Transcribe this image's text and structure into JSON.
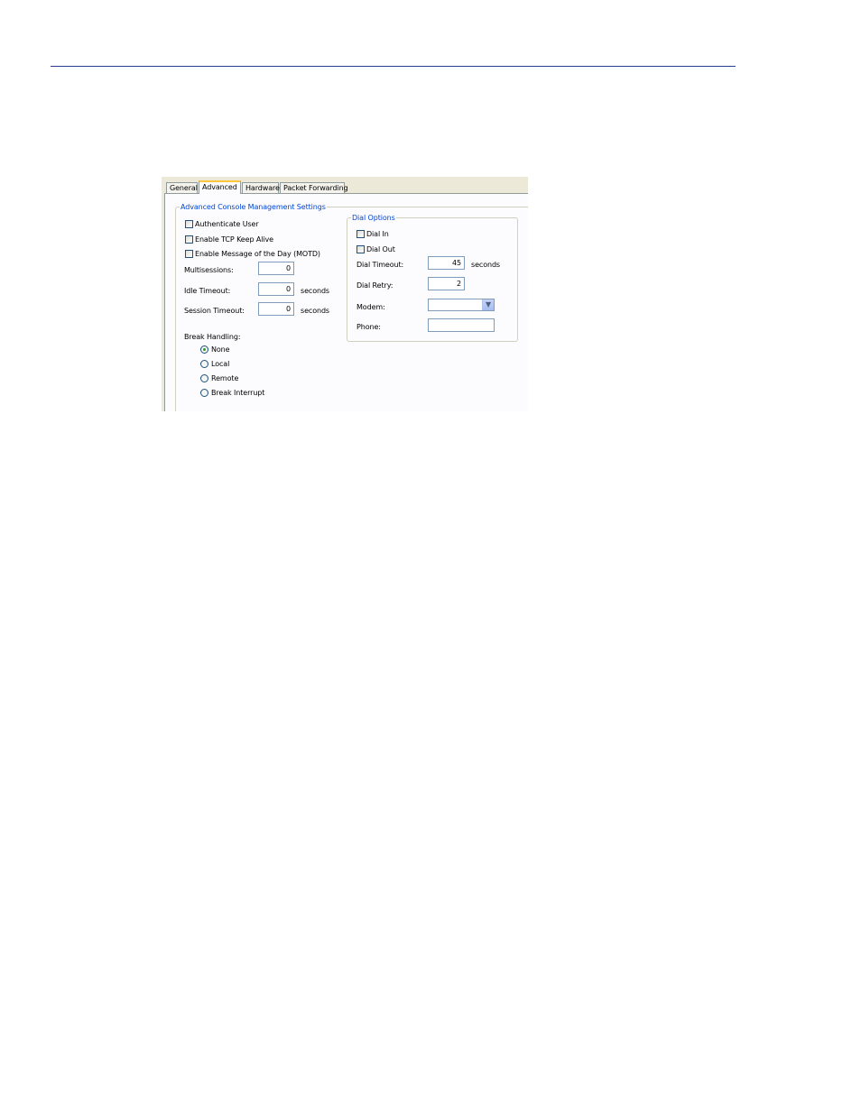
{
  "tabs": [
    "General",
    "Advanced",
    "Hardware",
    "Packet Forwarding"
  ],
  "console_group": {
    "legend": "Advanced Console Management Settings",
    "checkboxes": {
      "authenticate_user": "Authenticate User",
      "tcp_keep_alive": "Enable TCP Keep Alive",
      "motd": "Enable Message of the Day (MOTD)"
    },
    "multisessions": {
      "label": "Multisessions:",
      "value": "0"
    },
    "idle_timeout": {
      "label": "Idle Timeout:",
      "value": "0",
      "unit": "seconds"
    },
    "session_timeout": {
      "label": "Session Timeout:",
      "value": "0",
      "unit": "seconds"
    },
    "break_handling": {
      "label": "Break Handling:",
      "options": [
        "None",
        "Local",
        "Remote",
        "Break Interrupt"
      ],
      "selected": "None"
    }
  },
  "dial_group": {
    "legend": "Dial Options",
    "dial_in": "Dial In",
    "dial_out": "Dial Out",
    "dial_timeout": {
      "label": "Dial Timeout:",
      "value": "45",
      "unit": "seconds"
    },
    "dial_retry": {
      "label": "Dial Retry:",
      "value": "2"
    },
    "modem": {
      "label": "Modem:",
      "value": ""
    },
    "phone": {
      "label": "Phone:",
      "value": ""
    }
  },
  "colors": {
    "legend": "#0046d5",
    "rule": "#2b3f8c",
    "active_tab_accent": "#ffc83c"
  },
  "icons": {
    "dropdown": "chevron-down-icon"
  }
}
